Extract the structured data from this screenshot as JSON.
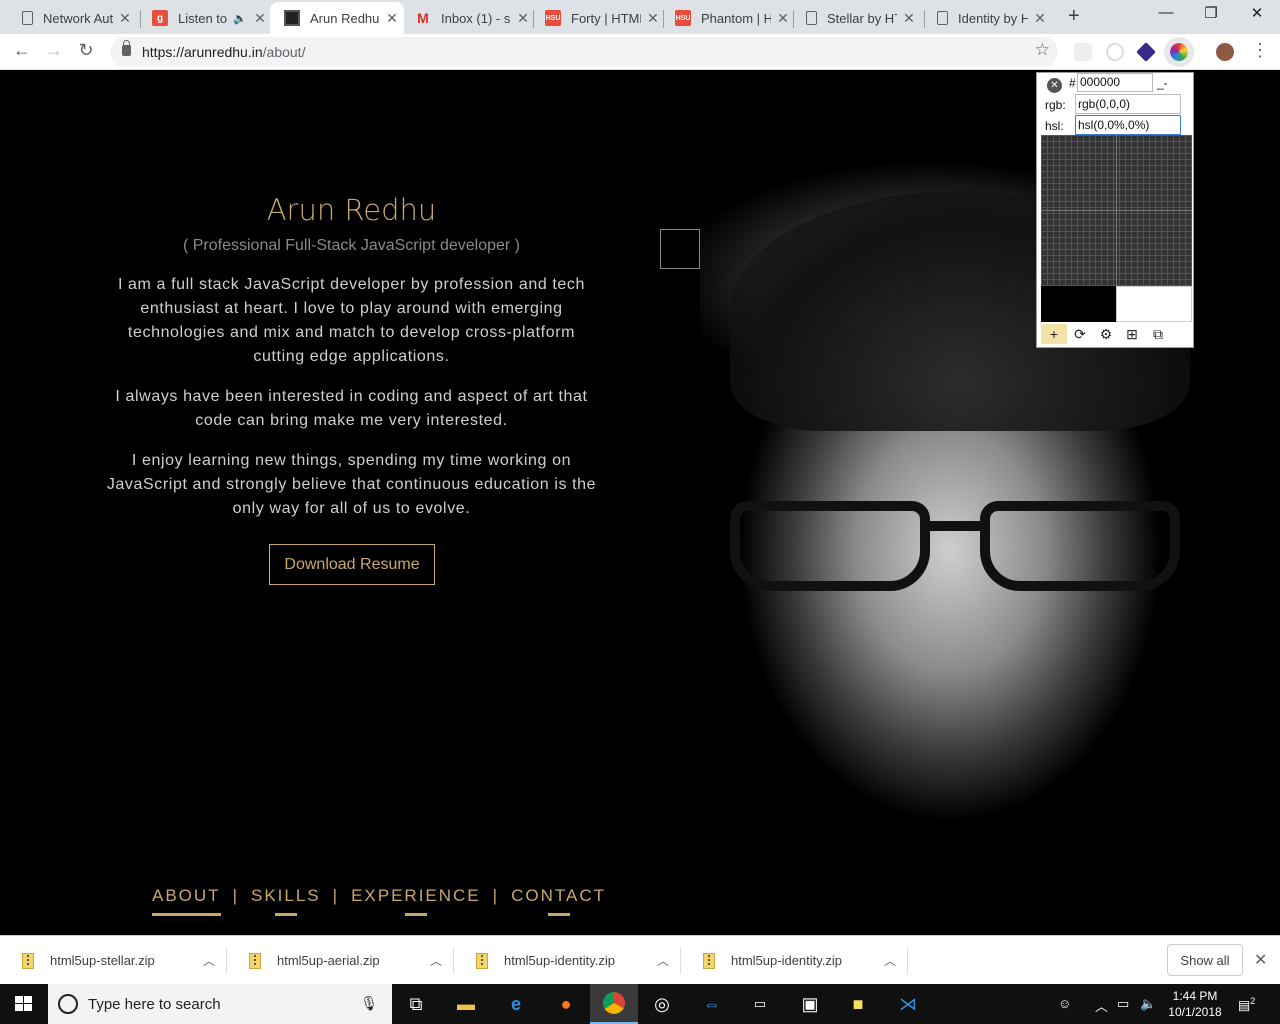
{
  "browser": {
    "tabs": [
      {
        "label": "Network Aut",
        "favicon": "doc-icon",
        "active": false
      },
      {
        "label": "Listen to",
        "favicon": "g-icon",
        "active": false,
        "audio": true
      },
      {
        "label": "Arun Redhu",
        "favicon": "site-icon",
        "active": true
      },
      {
        "label": "Inbox (1) - s",
        "favicon": "gmail-icon",
        "active": false
      },
      {
        "label": "Forty | HTML",
        "favicon": "hsu-icon",
        "active": false
      },
      {
        "label": "Phantom | H",
        "favicon": "hsu-icon",
        "active": false
      },
      {
        "label": "Stellar by HT",
        "favicon": "doc-icon",
        "active": false
      },
      {
        "label": "Identity by H",
        "favicon": "doc-icon",
        "active": false
      }
    ],
    "url_main": "https://arunredhu.in",
    "url_path": "/about/"
  },
  "page": {
    "name": "Arun Redhu",
    "subtitle": "( Professional Full-Stack JavaScript developer )",
    "para1": "I am a full stack JavaScript developer by profession and tech enthusiast at heart. I love to play around with emerging technologies and mix and match to develop cross-platform cutting edge applications.",
    "para2": "I always have been interested in coding and aspect of art that code can bring make me very interested.",
    "para3": "I enjoy learning new things, spending my time working on JavaScript and strongly believe that continuous education is the only way for all of us to evolve.",
    "resume_button": "Download Resume",
    "nav": [
      "ABOUT",
      "SKILLS",
      "EXPERIENCE",
      "CONTACT"
    ],
    "nav_separator": "|",
    "accent_color": "#c9a86b"
  },
  "color_picker": {
    "hash": "#",
    "hex": "000000",
    "dash": "_-",
    "rgb_label": "rgb:",
    "rgb_value": "rgb(0,0,0)",
    "hsl_label": "hsl:",
    "hsl_value": "hsl(0,0%,0%)",
    "tools": [
      "crosshair-icon",
      "refresh-icon",
      "gear-icon",
      "windows-icon",
      "popout-icon"
    ]
  },
  "downloads": {
    "items": [
      "html5up-stellar.zip",
      "html5up-aerial.zip",
      "html5up-identity.zip",
      "html5up-identity.zip"
    ],
    "show_all": "Show all"
  },
  "taskbar": {
    "search_placeholder": "Type here to search",
    "time": "1:44 PM",
    "date": "10/1/2018",
    "notification_count": "2"
  }
}
